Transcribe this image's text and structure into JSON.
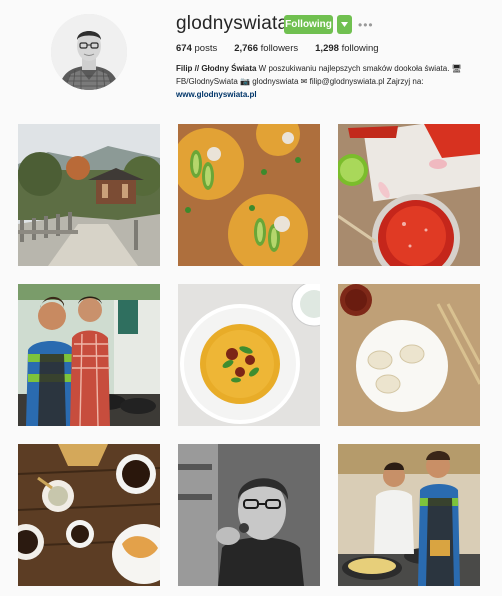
{
  "profile": {
    "username": "glodnyswiata",
    "follow_label": "Following",
    "more_label": "•••",
    "stats": [
      {
        "value": "674",
        "label": "posts"
      },
      {
        "value": "2,766",
        "label": "followers"
      },
      {
        "value": "1,298",
        "label": "following"
      }
    ],
    "bio_name": "Filip // Głodny Świata",
    "bio_line1_rest": " W poszukiwaniu najlepszych smaków dookoła świata. 🖥",
    "bio_line2": "FB/GlodnySwiata 📷 glodnyswiata ✉ filip@glodnyswiata.pl Zajrzyj na:",
    "website": "www.glodnyswiata.pl"
  },
  "colors": {
    "follow_green": "#70c050",
    "link_blue": "#003569"
  },
  "posts": [
    {
      "subject": "korean-palace-bridge"
    },
    {
      "subject": "avocado-tostadas"
    },
    {
      "subject": "tomato-salsa"
    },
    {
      "subject": "friends-cooking"
    },
    {
      "subject": "curry-soup-bowl"
    },
    {
      "subject": "dumplings-plate"
    },
    {
      "subject": "coffee-croissant-flatlay"
    },
    {
      "subject": "man-eating-bw"
    },
    {
      "subject": "cooking-class"
    }
  ]
}
